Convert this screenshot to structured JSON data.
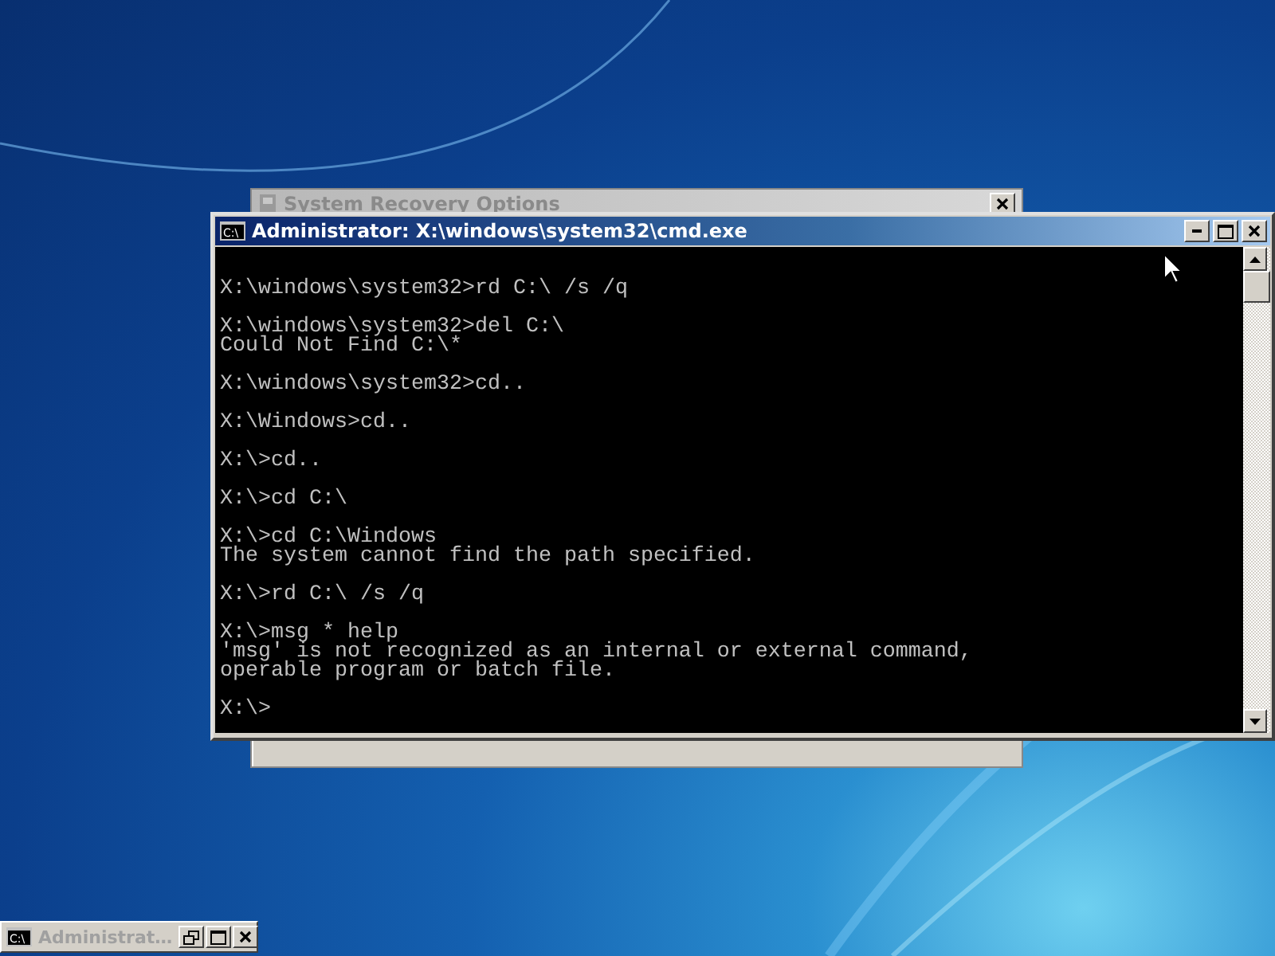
{
  "background_window": {
    "title": "System Recovery Options"
  },
  "console_window": {
    "icon_label": "C:\\",
    "title": "Administrator: X:\\windows\\system32\\cmd.exe",
    "blocks": [
      [
        "X:\\windows\\system32>rd C:\\ /s /q"
      ],
      [
        "X:\\windows\\system32>del C:\\",
        "Could Not Find C:\\*"
      ],
      [
        "X:\\windows\\system32>cd.."
      ],
      [
        "X:\\Windows>cd.."
      ],
      [
        "X:\\>cd.."
      ],
      [
        "X:\\>cd C:\\"
      ],
      [
        "X:\\>cd C:\\Windows",
        "The system cannot find the path specified."
      ],
      [
        "X:\\>rd C:\\ /s /q"
      ],
      [
        "X:\\>msg * help",
        "'msg' is not recognized as an internal or external command,",
        "operable program or batch file."
      ],
      [
        "X:\\>"
      ]
    ]
  },
  "minimized_window": {
    "icon_label": "C:\\",
    "title": "Administrat…"
  }
}
